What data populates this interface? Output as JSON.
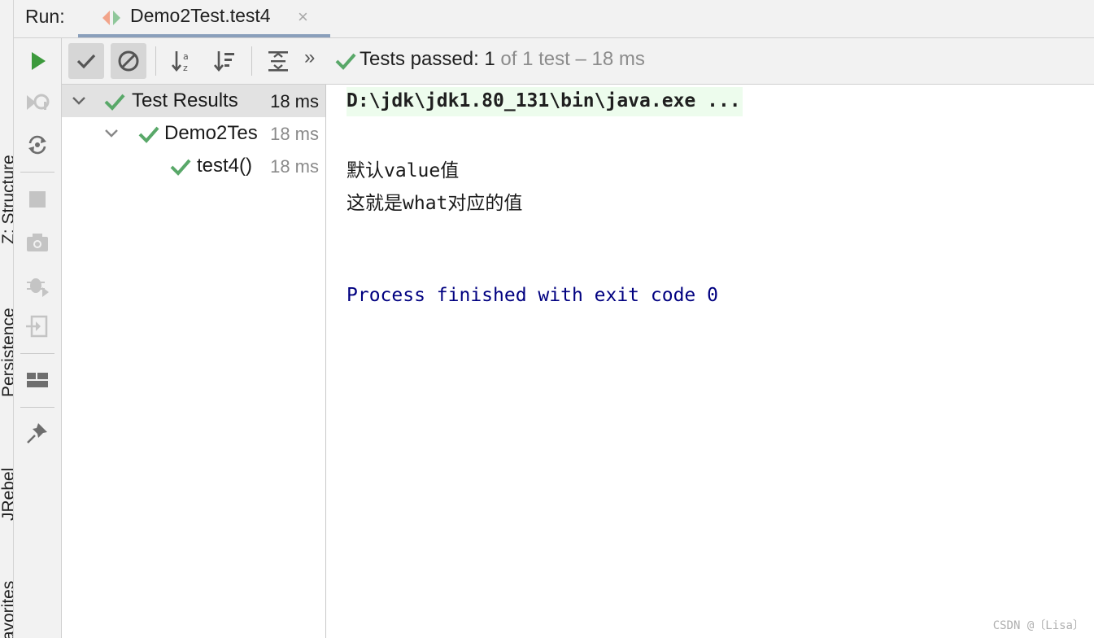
{
  "side_strip": {
    "labels": [
      "Z: Structure",
      "Persistence",
      "JRebel",
      "Favorites"
    ]
  },
  "run_header": {
    "label": "Run:",
    "tab_title": "Demo2Test.test4",
    "tab_close": "×"
  },
  "left_toolbar": {
    "icons": [
      "run-icon",
      "rerun-failed-icon",
      "toggle-autotest-icon",
      "stop-icon",
      "screenshot-icon",
      "debug-exception-icon",
      "import-tests-icon",
      "layout-icon",
      "pin-icon"
    ]
  },
  "test_toolbar": {
    "icons": [
      "show-passed-icon",
      "show-ignored-icon",
      "sort-alpha-icon",
      "sort-duration-icon",
      "expand-all-icon",
      "more-icon"
    ],
    "status_main": "Tests passed: 1",
    "status_dim": " of 1 test – 18 ms",
    "more": "»"
  },
  "tree": {
    "rows": [
      {
        "name": "Test Results",
        "time": "18 ms"
      },
      {
        "name": "Demo2Tes",
        "time": "18 ms"
      },
      {
        "name": "test4()",
        "time": "18 ms"
      }
    ]
  },
  "console": {
    "command": "D:\\jdk\\jdk1.80_131\\bin\\java.exe ...",
    "output_1": "默认value值",
    "output_2": "这就是what对应的值",
    "exit": "Process finished with exit code 0"
  },
  "watermark": "CSDN @〔Lisa〕",
  "colors": {
    "pass_green": "#59a869",
    "run_green": "#3c9a3c",
    "exit_blue": "#000080",
    "tab_underline": "#8a9fbb"
  }
}
